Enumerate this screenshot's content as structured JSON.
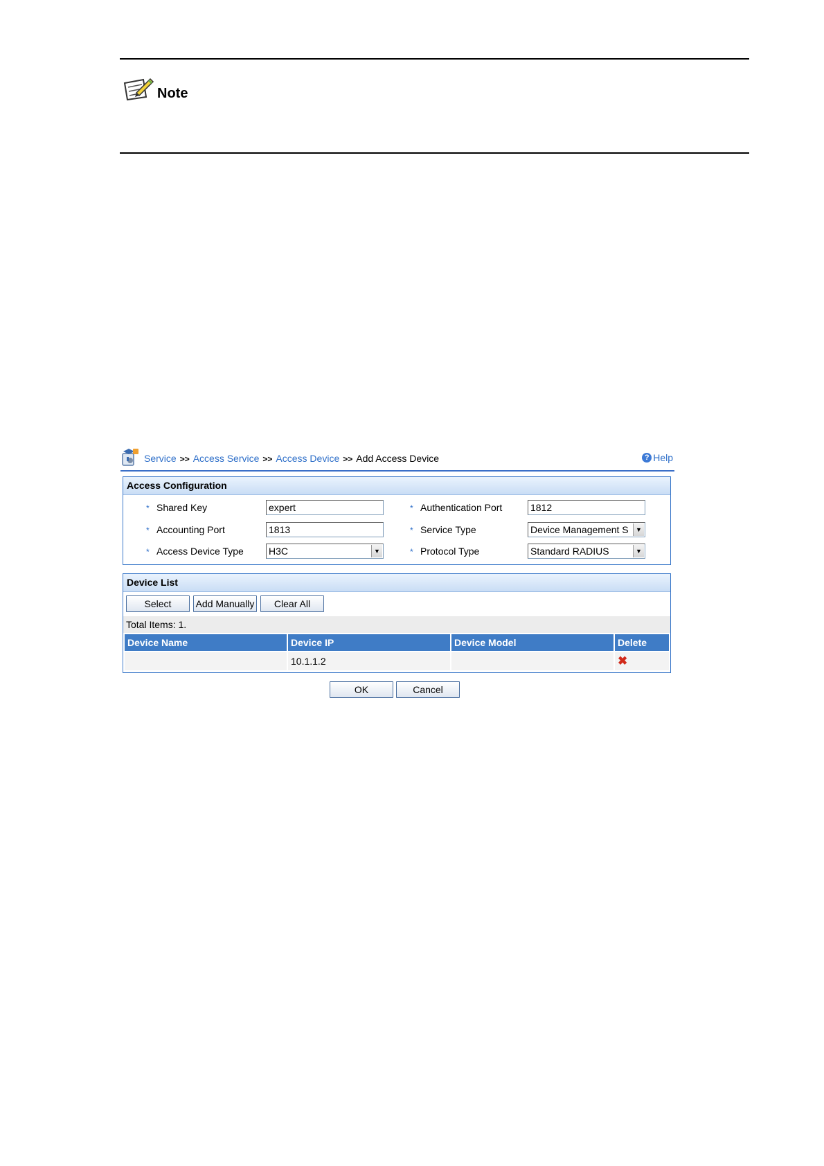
{
  "note": {
    "label": "Note"
  },
  "breadcrumb": {
    "items": [
      "Service",
      "Access Service",
      "Access Device"
    ],
    "separator": ">>",
    "current": "Add Access Device",
    "help": "Help"
  },
  "access_config": {
    "title": "Access Configuration",
    "shared_key": {
      "label": "Shared Key",
      "value": "expert"
    },
    "authentication_port": {
      "label": "Authentication Port",
      "value": "1812"
    },
    "accounting_port": {
      "label": "Accounting Port",
      "value": "1813"
    },
    "service_type": {
      "label": "Service Type",
      "value": "Device Management S"
    },
    "access_device_type": {
      "label": "Access Device Type",
      "value": "H3C"
    },
    "protocol_type": {
      "label": "Protocol Type",
      "value": "Standard RADIUS"
    },
    "required_mark": "*"
  },
  "device_list": {
    "title": "Device List",
    "buttons": {
      "select": "Select",
      "add_manually": "Add Manually",
      "clear_all": "Clear All"
    },
    "total_items": "Total Items: 1.",
    "columns": [
      "Device Name",
      "Device IP",
      "Device Model",
      "Delete"
    ],
    "rows": [
      {
        "device_name": "",
        "device_ip": "10.1.1.2",
        "device_model": ""
      }
    ]
  },
  "actions": {
    "ok": "OK",
    "cancel": "Cancel"
  },
  "colors": {
    "accent": "#3a78c9",
    "link": "#2e6fc9",
    "header": "#3f7cc6",
    "delete": "#d12a1a"
  }
}
